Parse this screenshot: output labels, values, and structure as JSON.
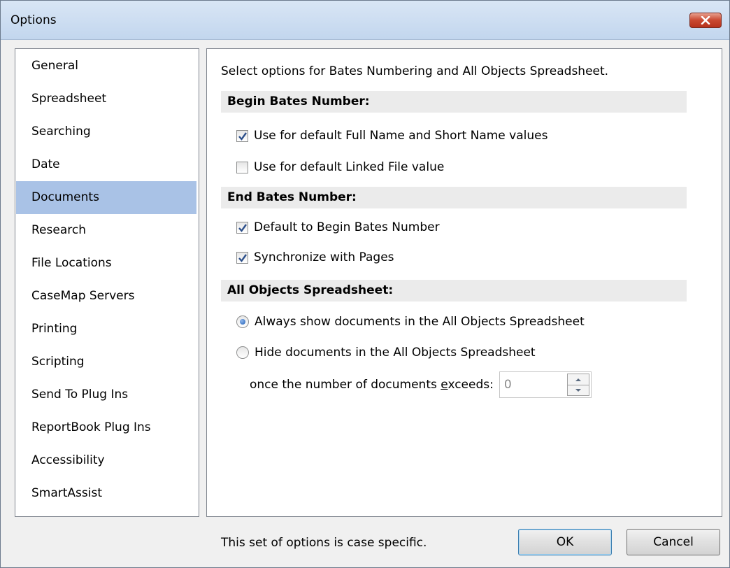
{
  "window": {
    "title": "Options"
  },
  "sidebar": {
    "items": [
      {
        "label": "General"
      },
      {
        "label": "Spreadsheet"
      },
      {
        "label": "Searching"
      },
      {
        "label": "Date"
      },
      {
        "label": "Documents",
        "selected": true
      },
      {
        "label": "Research"
      },
      {
        "label": "File Locations"
      },
      {
        "label": "CaseMap Servers"
      },
      {
        "label": "Printing"
      },
      {
        "label": "Scripting"
      },
      {
        "label": "Send To Plug Ins"
      },
      {
        "label": "ReportBook Plug Ins"
      },
      {
        "label": "Accessibility"
      },
      {
        "label": "SmartAssist"
      }
    ]
  },
  "content": {
    "intro": "Select options for Bates Numbering and All Objects Spreadsheet.",
    "begin_bates": {
      "header": "Begin Bates Number:",
      "opt_full_short": {
        "label": "Use for default Full Name and Short Name values",
        "checked": true
      },
      "opt_linked_file": {
        "label": "Use for default Linked File value",
        "checked": false
      }
    },
    "end_bates": {
      "header": "End Bates Number:",
      "opt_default_begin": {
        "label": "Default to Begin Bates Number",
        "checked": true
      },
      "opt_sync_pages": {
        "label": "Synchronize with Pages",
        "checked": true
      }
    },
    "all_objects": {
      "header": "All Objects Spreadsheet:",
      "radio_always": {
        "label": "Always show documents in the All Objects Spreadsheet",
        "selected": true
      },
      "radio_hide": {
        "label": "Hide documents in the All Objects Spreadsheet",
        "selected": false
      },
      "exceeds_label_pre": "once the number of documents ",
      "exceeds_label_accel": "e",
      "exceeds_label_post": "xceeds:",
      "exceeds_value": "0"
    }
  },
  "footer": {
    "note": "This set of options is case specific.",
    "ok_label": "OK",
    "cancel_label": "Cancel"
  },
  "colors": {
    "selected_item_bg": "#a9c2e6",
    "close_button": "#c9472f",
    "check_mark": "#2c4f8a"
  }
}
